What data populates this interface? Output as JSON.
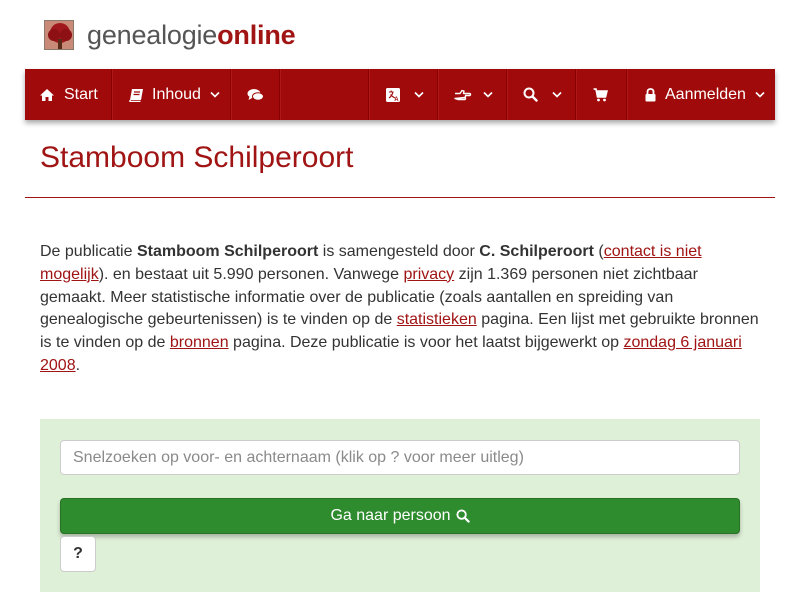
{
  "brand": {
    "name_part1": "genealogie",
    "name_part2": "online"
  },
  "nav": {
    "start_label": "Start",
    "inhoud_label": "Inhoud",
    "login_label": "Aanmelden",
    "icons": [
      "home-icon",
      "book-icon",
      "comments-icon",
      "language-icon",
      "hand-pointer-icon",
      "search-icon",
      "cart-icon",
      "lock-icon"
    ]
  },
  "page": {
    "title": "Stamboom Schilperoort"
  },
  "intro": {
    "t1": "De publicatie ",
    "pub_name": "Stamboom Schilperoort",
    "t2": " is samengesteld door ",
    "author": "C. Schilperoort",
    "t3": " (",
    "contact_link": "contact is niet mogelijk",
    "t4": "). en bestaat uit 5.990 personen. Vanwege ",
    "privacy_link": "privacy",
    "t5": " zijn 1.369 personen niet zichtbaar gemaakt. Meer statistische informatie over de publicatie (zoals aantallen en spreiding van genealogische gebeurtenissen) is te vinden op de ",
    "stats_link": "statistieken",
    "t6": " pagina. Een lijst met gebruikte bronnen is te vinden op de ",
    "sources_link": "bronnen",
    "t7": " pagina. Deze publicatie is voor het laatst bijgewerkt op ",
    "date_link": "zondag 6 januari 2008",
    "t8": "."
  },
  "search": {
    "placeholder": "Snelzoeken op voor- en achternaam (klik op ? voor meer uitleg)",
    "button_label": "Ga naar persoon",
    "help_label": "?"
  },
  "colors": {
    "brand_red": "#a00a0a",
    "link_red": "#a01414",
    "panel_green": "#dff0d8",
    "button_green": "#2e8b2e"
  }
}
